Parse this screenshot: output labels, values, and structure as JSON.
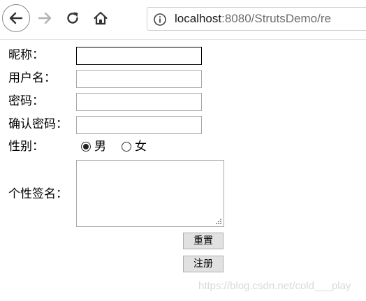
{
  "browser": {
    "url_host": "localhost",
    "url_rest": ":8080/StrutsDemo/re"
  },
  "form": {
    "nickname_label": "昵称：",
    "username_label": "用户名：",
    "password_label": "密码：",
    "confirm_password_label": "确认密码：",
    "gender_label": "性别：",
    "gender_options": [
      {
        "label": "男",
        "checked": true
      },
      {
        "label": "女",
        "checked": false
      }
    ],
    "signature_label": "个性签名：",
    "reset_button": "重置",
    "register_button": "注册"
  },
  "watermark": "https://blog.csdn.net/cold___play",
  "icons": {
    "back": "back-arrow-icon",
    "forward": "forward-arrow-icon",
    "reload": "reload-icon",
    "home": "home-icon",
    "info": "info-icon",
    "resize": "resize-grip-icon"
  }
}
